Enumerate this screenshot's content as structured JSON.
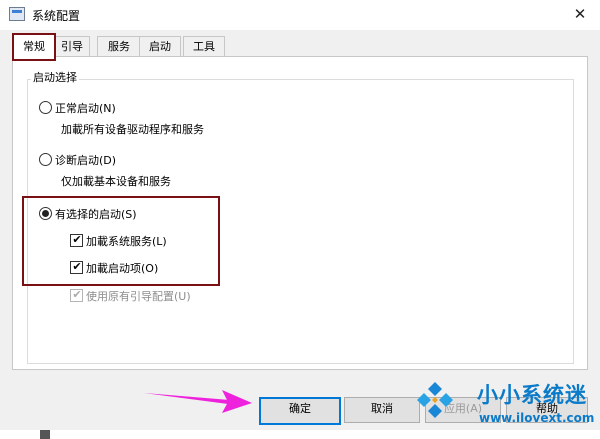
{
  "window": {
    "title": "系统配置",
    "close_glyph": "✕"
  },
  "tabs": [
    {
      "label": "常规",
      "active": true
    },
    {
      "label": "引导",
      "active": false
    },
    {
      "label": "服务",
      "active": false
    },
    {
      "label": "启动",
      "active": false
    },
    {
      "label": "工具",
      "active": false
    }
  ],
  "startup": {
    "group_title": "启动选择",
    "normal": {
      "label": "正常启动(N)",
      "desc": "加載所有设备驱动程序和服务",
      "checked": false
    },
    "diagnostic": {
      "label": "诊断启动(D)",
      "desc": "仅加載基本设备和服务",
      "checked": false
    },
    "selective": {
      "label": "有选择的启动(S)",
      "checked": true,
      "load_services": {
        "label": "加載系统服务(L)",
        "checked": true
      },
      "load_startup": {
        "label": "加載启动项(O)",
        "checked": true
      },
      "use_original_boot": {
        "label": "使用原有引导配置(U)",
        "checked": true,
        "disabled": true
      }
    }
  },
  "buttons": {
    "ok": "确定",
    "cancel": "取消",
    "apply": "应用(A)",
    "help": "帮助"
  },
  "watermark": {
    "name": "小小系统迷",
    "url": "www.ilovext.com"
  },
  "colors": {
    "highlight_border": "#7b1014",
    "arrow": "#ee22dd",
    "accent": "#0078d7",
    "watermark": "#0a7ac9"
  }
}
